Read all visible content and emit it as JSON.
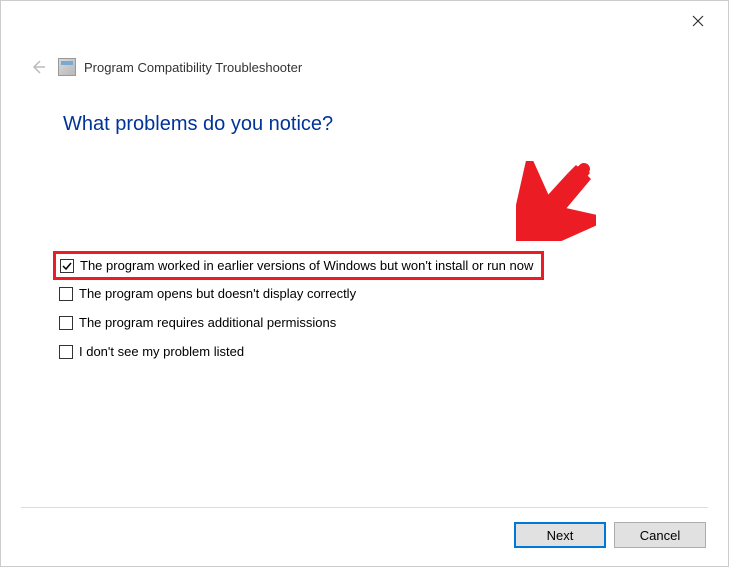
{
  "window": {
    "title": "Program Compatibility Troubleshooter"
  },
  "main": {
    "heading": "What problems do you notice?"
  },
  "options": [
    {
      "label": "The program worked in earlier versions of Windows but won't install or run now",
      "checked": true,
      "highlighted": true
    },
    {
      "label": "The program opens but doesn't display correctly",
      "checked": false,
      "highlighted": false
    },
    {
      "label": "The program requires additional permissions",
      "checked": false,
      "highlighted": false
    },
    {
      "label": "I don't see my problem listed",
      "checked": false,
      "highlighted": false
    }
  ],
  "buttons": {
    "next": "Next",
    "cancel": "Cancel"
  },
  "annotation": {
    "arrow_color": "#ec1c24",
    "highlight_color": "#ec1c24"
  }
}
